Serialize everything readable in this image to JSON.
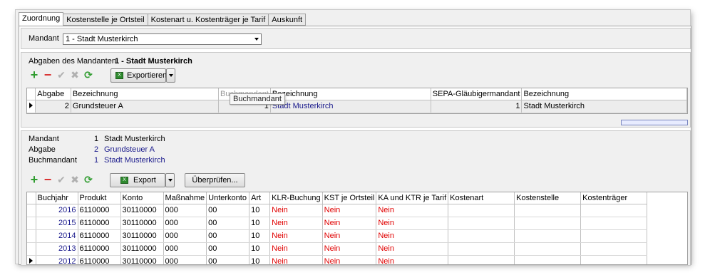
{
  "tabs": [
    "Zuordnung",
    "Kostenstelle je Ortsteil",
    "Kostenart u. Kostenträger je Tarif",
    "Auskunft"
  ],
  "mandant_bar": {
    "label": "Mandant",
    "selected": "1 - Stadt Musterkirch"
  },
  "abgaben_section": {
    "title_label": "Abgaben des Mandanten",
    "title_value": "1 - Stadt Musterkirch",
    "export_label": "Exportieren",
    "columns": [
      "Abgabe",
      "Bezeichnung",
      "Buchmandant",
      "Bezeichnung",
      "SEPA-Gläubigermandant",
      "Bezeichnung"
    ],
    "rows": [
      {
        "abgabe": "2",
        "bezeichnung": "Grundsteuer A",
        "buchmandant": "1",
        "buch_bezeichnung": "Stadt Musterkirch",
        "sepa": "1",
        "sepa_bezeichnung": "Stadt Musterkirch"
      }
    ],
    "tooltip": "Buchmandant"
  },
  "detail_section": {
    "info": [
      {
        "label": "Mandant",
        "num": "1",
        "value": "Stadt Musterkirch"
      },
      {
        "label": "Abgabe",
        "num": "2",
        "value": "Grundsteuer A"
      },
      {
        "label": "Buchmandant",
        "num": "1",
        "value": "Stadt Musterkirch"
      }
    ],
    "export_label": "Export",
    "check_label": "Überprüfen...",
    "columns": [
      "Buchjahr",
      "Produkt",
      "Konto",
      "Maßnahme",
      "Unterkonto",
      "Art",
      "KLR-Buchung",
      "KST je Ortsteil",
      "KA und KTR je Tarif",
      "Kostenart",
      "Kostenstelle",
      "Kostenträger"
    ],
    "rows": [
      {
        "buchjahr": "2016",
        "produkt": "6110000",
        "konto": "30110000",
        "massnahme": "000",
        "unterkonto": "00",
        "art": "10",
        "klr": "Nein",
        "kst": "Nein",
        "ka": "Nein",
        "kostenart": "",
        "kostenstelle": "",
        "kostentraeger": ""
      },
      {
        "buchjahr": "2015",
        "produkt": "6110000",
        "konto": "30110000",
        "massnahme": "000",
        "unterkonto": "00",
        "art": "10",
        "klr": "Nein",
        "kst": "Nein",
        "ka": "Nein",
        "kostenart": "",
        "kostenstelle": "",
        "kostentraeger": ""
      },
      {
        "buchjahr": "2014",
        "produkt": "6110000",
        "konto": "30110000",
        "massnahme": "000",
        "unterkonto": "00",
        "art": "10",
        "klr": "Nein",
        "kst": "Nein",
        "ka": "Nein",
        "kostenart": "",
        "kostenstelle": "",
        "kostentraeger": ""
      },
      {
        "buchjahr": "2013",
        "produkt": "6110000",
        "konto": "30110000",
        "massnahme": "000",
        "unterkonto": "00",
        "art": "10",
        "klr": "Nein",
        "kst": "Nein",
        "ka": "Nein",
        "kostenart": "",
        "kostenstelle": "",
        "kostentraeger": ""
      },
      {
        "buchjahr": "2012",
        "produkt": "6110000",
        "konto": "30110000",
        "massnahme": "000",
        "unterkonto": "00",
        "art": "10",
        "klr": "Nein",
        "kst": "Nein",
        "ka": "Nein",
        "kostenart": "",
        "kostenstelle": "",
        "kostentraeger": ""
      }
    ]
  },
  "colors": {
    "link_blue": "#1a1a8c",
    "no_red": "#e00000",
    "add_green": "#2f9c2f",
    "remove_red": "#d83030"
  },
  "icons": [
    "add-icon",
    "remove-icon",
    "confirm-icon",
    "cancel-icon",
    "refresh-icon",
    "excel-icon"
  ]
}
